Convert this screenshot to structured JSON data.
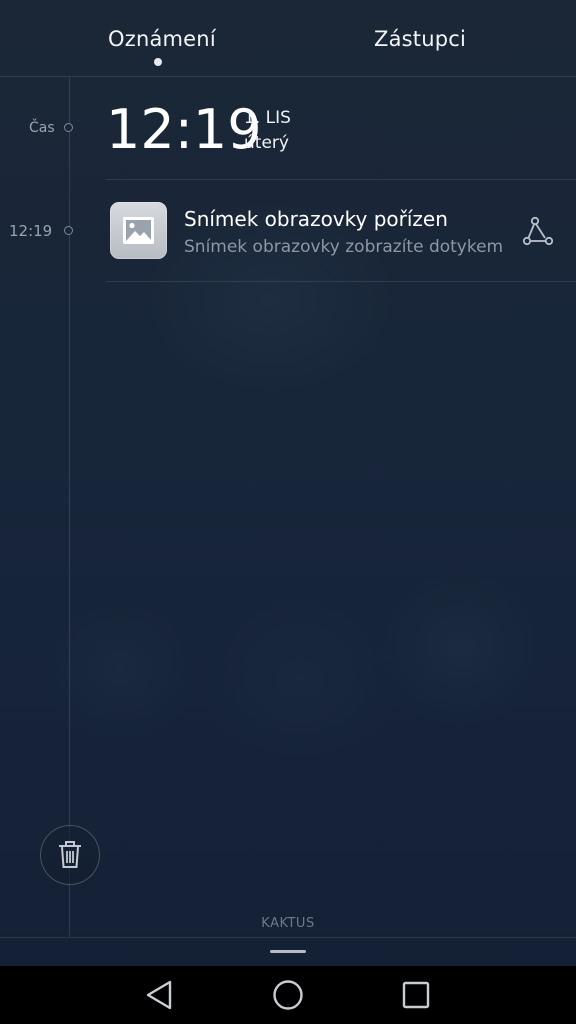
{
  "tabs": {
    "notifications": "Oznámení",
    "shortcuts": "Zástupci",
    "active": "notifications"
  },
  "timeline": {
    "time_label": "Čas",
    "notification_time": "12:19"
  },
  "clock": {
    "time": "12:19",
    "date": "1. LIS",
    "weekday": "úterý"
  },
  "notification": {
    "icon": "image-icon",
    "title": "Snímek obrazovky pořízen",
    "text": "Snímek obrazovky zobrazíte dotykem",
    "action_icon": "share-icon"
  },
  "clear_all": {
    "icon": "trash-icon"
  },
  "carrier": "KAKTUS",
  "navbar": {
    "back_icon": "back-triangle-icon",
    "home_icon": "home-circle-icon",
    "recent_icon": "recents-square-icon"
  },
  "colors": {
    "background_top": "#1b2736",
    "background_bottom": "#142034",
    "text_primary": "#ffffff",
    "text_secondary": "#8e97a3",
    "navbar": "#000000"
  }
}
